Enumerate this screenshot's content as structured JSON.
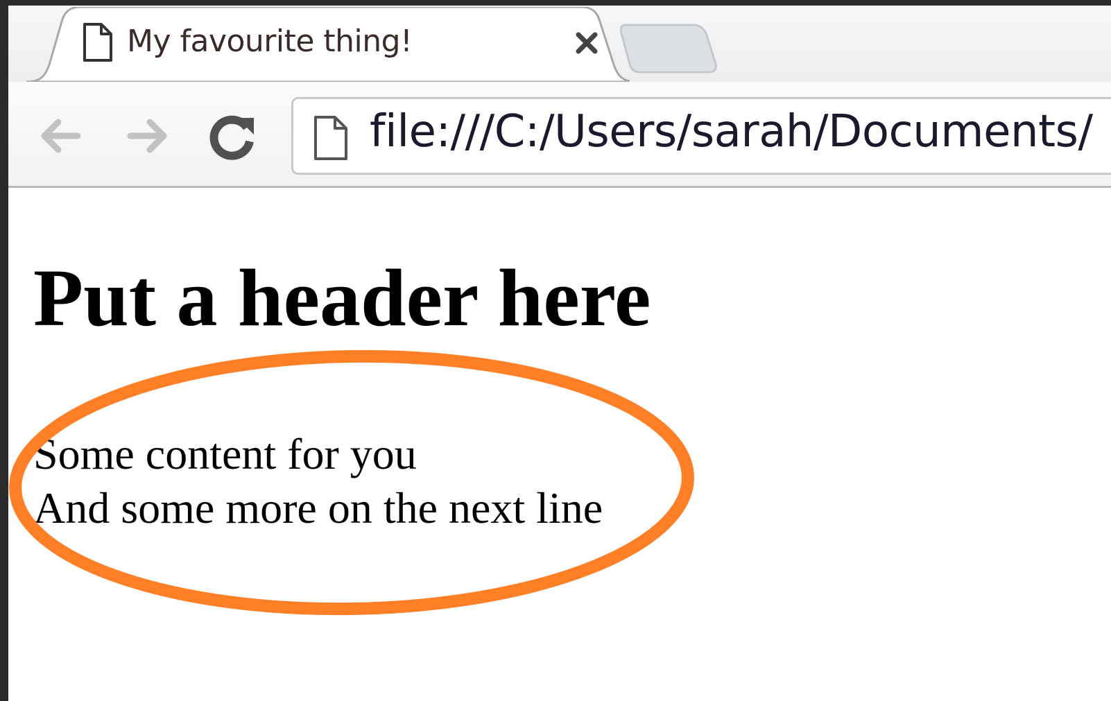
{
  "tab": {
    "title": "My favourite thing!",
    "icon": "page-icon",
    "close_icon": "close-icon"
  },
  "toolbar": {
    "back_icon": "back-arrow-icon",
    "forward_icon": "forward-arrow-icon",
    "reload_icon": "reload-icon",
    "url": "file:///C:/Users/sarah/Documents/"
  },
  "page": {
    "heading": "Put a header here",
    "lines": [
      "Some content for you",
      "And some more on the next line"
    ]
  },
  "annotation": {
    "shape": "ellipse",
    "color": "#ff7f27"
  },
  "colors": {
    "background_frame": "#2b2b2b",
    "tab_text": "#3b2a2a",
    "annotation": "#ff7f27"
  }
}
